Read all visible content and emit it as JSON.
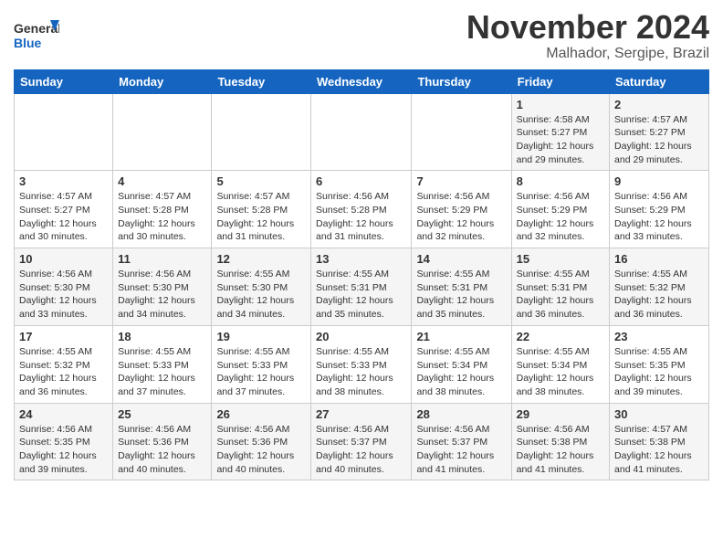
{
  "header": {
    "logo_line1": "General",
    "logo_line2": "Blue",
    "month": "November 2024",
    "location": "Malhador, Sergipe, Brazil"
  },
  "weekdays": [
    "Sunday",
    "Monday",
    "Tuesday",
    "Wednesday",
    "Thursday",
    "Friday",
    "Saturday"
  ],
  "weeks": [
    [
      {
        "day": "",
        "info": ""
      },
      {
        "day": "",
        "info": ""
      },
      {
        "day": "",
        "info": ""
      },
      {
        "day": "",
        "info": ""
      },
      {
        "day": "",
        "info": ""
      },
      {
        "day": "1",
        "info": "Sunrise: 4:58 AM\nSunset: 5:27 PM\nDaylight: 12 hours\nand 29 minutes."
      },
      {
        "day": "2",
        "info": "Sunrise: 4:57 AM\nSunset: 5:27 PM\nDaylight: 12 hours\nand 29 minutes."
      }
    ],
    [
      {
        "day": "3",
        "info": "Sunrise: 4:57 AM\nSunset: 5:27 PM\nDaylight: 12 hours\nand 30 minutes."
      },
      {
        "day": "4",
        "info": "Sunrise: 4:57 AM\nSunset: 5:28 PM\nDaylight: 12 hours\nand 30 minutes."
      },
      {
        "day": "5",
        "info": "Sunrise: 4:57 AM\nSunset: 5:28 PM\nDaylight: 12 hours\nand 31 minutes."
      },
      {
        "day": "6",
        "info": "Sunrise: 4:56 AM\nSunset: 5:28 PM\nDaylight: 12 hours\nand 31 minutes."
      },
      {
        "day": "7",
        "info": "Sunrise: 4:56 AM\nSunset: 5:29 PM\nDaylight: 12 hours\nand 32 minutes."
      },
      {
        "day": "8",
        "info": "Sunrise: 4:56 AM\nSunset: 5:29 PM\nDaylight: 12 hours\nand 32 minutes."
      },
      {
        "day": "9",
        "info": "Sunrise: 4:56 AM\nSunset: 5:29 PM\nDaylight: 12 hours\nand 33 minutes."
      }
    ],
    [
      {
        "day": "10",
        "info": "Sunrise: 4:56 AM\nSunset: 5:30 PM\nDaylight: 12 hours\nand 33 minutes."
      },
      {
        "day": "11",
        "info": "Sunrise: 4:56 AM\nSunset: 5:30 PM\nDaylight: 12 hours\nand 34 minutes."
      },
      {
        "day": "12",
        "info": "Sunrise: 4:55 AM\nSunset: 5:30 PM\nDaylight: 12 hours\nand 34 minutes."
      },
      {
        "day": "13",
        "info": "Sunrise: 4:55 AM\nSunset: 5:31 PM\nDaylight: 12 hours\nand 35 minutes."
      },
      {
        "day": "14",
        "info": "Sunrise: 4:55 AM\nSunset: 5:31 PM\nDaylight: 12 hours\nand 35 minutes."
      },
      {
        "day": "15",
        "info": "Sunrise: 4:55 AM\nSunset: 5:31 PM\nDaylight: 12 hours\nand 36 minutes."
      },
      {
        "day": "16",
        "info": "Sunrise: 4:55 AM\nSunset: 5:32 PM\nDaylight: 12 hours\nand 36 minutes."
      }
    ],
    [
      {
        "day": "17",
        "info": "Sunrise: 4:55 AM\nSunset: 5:32 PM\nDaylight: 12 hours\nand 36 minutes."
      },
      {
        "day": "18",
        "info": "Sunrise: 4:55 AM\nSunset: 5:33 PM\nDaylight: 12 hours\nand 37 minutes."
      },
      {
        "day": "19",
        "info": "Sunrise: 4:55 AM\nSunset: 5:33 PM\nDaylight: 12 hours\nand 37 minutes."
      },
      {
        "day": "20",
        "info": "Sunrise: 4:55 AM\nSunset: 5:33 PM\nDaylight: 12 hours\nand 38 minutes."
      },
      {
        "day": "21",
        "info": "Sunrise: 4:55 AM\nSunset: 5:34 PM\nDaylight: 12 hours\nand 38 minutes."
      },
      {
        "day": "22",
        "info": "Sunrise: 4:55 AM\nSunset: 5:34 PM\nDaylight: 12 hours\nand 38 minutes."
      },
      {
        "day": "23",
        "info": "Sunrise: 4:55 AM\nSunset: 5:35 PM\nDaylight: 12 hours\nand 39 minutes."
      }
    ],
    [
      {
        "day": "24",
        "info": "Sunrise: 4:56 AM\nSunset: 5:35 PM\nDaylight: 12 hours\nand 39 minutes."
      },
      {
        "day": "25",
        "info": "Sunrise: 4:56 AM\nSunset: 5:36 PM\nDaylight: 12 hours\nand 40 minutes."
      },
      {
        "day": "26",
        "info": "Sunrise: 4:56 AM\nSunset: 5:36 PM\nDaylight: 12 hours\nand 40 minutes."
      },
      {
        "day": "27",
        "info": "Sunrise: 4:56 AM\nSunset: 5:37 PM\nDaylight: 12 hours\nand 40 minutes."
      },
      {
        "day": "28",
        "info": "Sunrise: 4:56 AM\nSunset: 5:37 PM\nDaylight: 12 hours\nand 41 minutes."
      },
      {
        "day": "29",
        "info": "Sunrise: 4:56 AM\nSunset: 5:38 PM\nDaylight: 12 hours\nand 41 minutes."
      },
      {
        "day": "30",
        "info": "Sunrise: 4:57 AM\nSunset: 5:38 PM\nDaylight: 12 hours\nand 41 minutes."
      }
    ]
  ]
}
